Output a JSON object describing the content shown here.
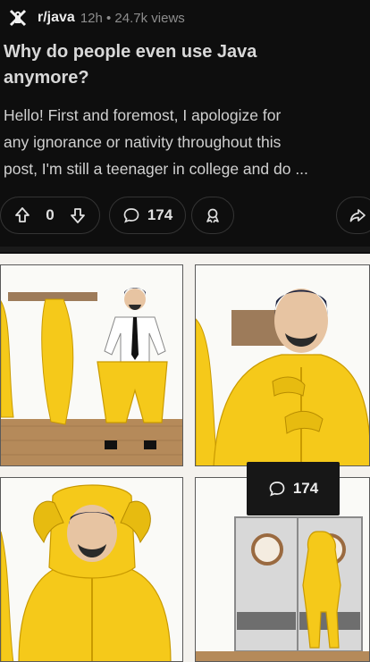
{
  "post": {
    "community": "r/java",
    "meta": "12h • 24.7k views",
    "title_line1": "Why do people even use Java",
    "title_line2": "anymore?",
    "body_line1": "Hello! First and foremost, I apologize for",
    "body_line2": "any ignorance or nativity throughout this",
    "body_line3": "post, I'm still a teenager in college and do ..."
  },
  "actions": {
    "vote_count": "0",
    "comment_count": "174"
  },
  "meme": {
    "floating_comment_count": "174"
  },
  "icons": {
    "community": "community-icon",
    "upvote": "upvote-icon",
    "downvote": "downvote-icon",
    "comment": "comment-icon",
    "award": "award-icon",
    "share": "share-icon"
  },
  "colors": {
    "background": "#0e0e0e",
    "hazmat_yellow": "#f5c91a",
    "pill_border": "#343434"
  }
}
